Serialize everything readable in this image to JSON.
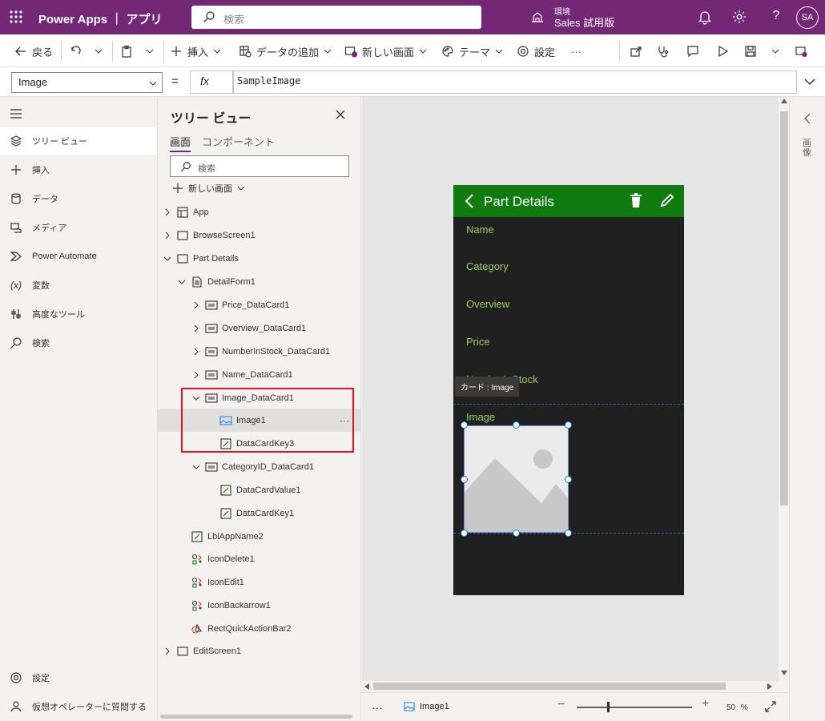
{
  "topbar": {
    "app_title": "Power Apps ｜ アプリ",
    "search_placeholder": "検索",
    "env_label": "環境",
    "env_name": "Sales 試用版",
    "avatar_initials": "SA",
    "bg_color": "#742774"
  },
  "commands": {
    "back": "戻る",
    "insert": "挿入",
    "add_data": "データの追加",
    "new_screen": "新しい画面",
    "theme": "テーマ",
    "settings": "設定",
    "more": "···"
  },
  "formula_bar": {
    "property": "Image",
    "equals": "=",
    "fx": "fx",
    "formula": "SampleImage"
  },
  "left_rail": {
    "items": [
      {
        "label": "ツリー ビュー",
        "icon": "layers-icon"
      },
      {
        "label": "挿入",
        "icon": "plus-icon"
      },
      {
        "label": "データ",
        "icon": "database-icon"
      },
      {
        "label": "メディア",
        "icon": "media-icon"
      },
      {
        "label": "Power Automate",
        "icon": "power-automate-icon"
      },
      {
        "label": "変数",
        "icon": "variable-icon"
      },
      {
        "label": "高度なツール",
        "icon": "tools-icon"
      },
      {
        "label": "検索",
        "icon": "search-icon"
      }
    ],
    "settings": "設定",
    "virtual_agent": "仮想オペレーターに質問する"
  },
  "tree": {
    "title": "ツリー ビュー",
    "tab_screens": "画面",
    "tab_components": "コンポーネント",
    "search_placeholder": "検索",
    "new_screen": "新しい画面",
    "rows": [
      {
        "label": "App"
      },
      {
        "label": "BrowseScreen1"
      },
      {
        "label": "Part Details"
      },
      {
        "label": "DetailForm1"
      },
      {
        "label": "Price_DataCard1"
      },
      {
        "label": "Overview_DataCard1"
      },
      {
        "label": "NumberInStock_DataCard1"
      },
      {
        "label": "Name_DataCard1"
      },
      {
        "label": "Image_DataCard1"
      },
      {
        "label": "Image1"
      },
      {
        "label": "DataCardKey3"
      },
      {
        "label": "CategoryID_DataCard1"
      },
      {
        "label": "DataCardValue1"
      },
      {
        "label": "DataCardKey1"
      },
      {
        "label": "LblAppName2"
      },
      {
        "label": "IconDelete1"
      },
      {
        "label": "IconEdit1"
      },
      {
        "label": "IconBackarrow1"
      },
      {
        "label": "RectQuickActionBar2"
      },
      {
        "label": "EditScreen1"
      }
    ],
    "more": "···"
  },
  "phone": {
    "title": "Part Details",
    "header_color": "#107c10",
    "fields": [
      "Name",
      "Category",
      "Overview",
      "Price",
      "NumberInStock",
      "Image"
    ],
    "tooltip": "カード : Image"
  },
  "status_bar": {
    "more": "···",
    "crumb": "Image1",
    "zoom": "50",
    "zoom_unit": "%",
    "zoom_level": 0.27
  },
  "right_panel": {
    "label": "画像"
  }
}
